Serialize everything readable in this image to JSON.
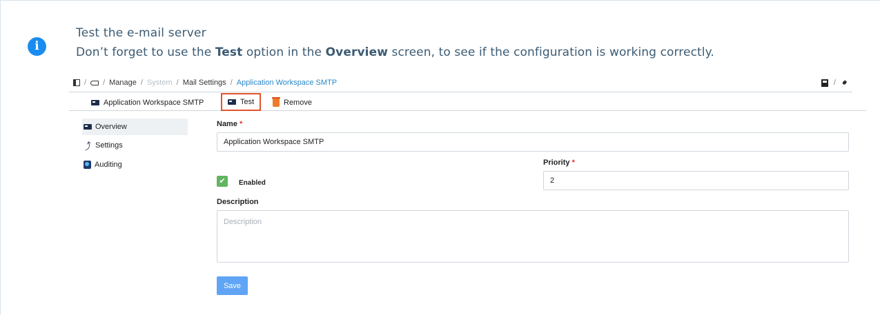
{
  "info": {
    "icon": "info-icon",
    "title": "Test the e-mail server",
    "text_prefix": "Don’t forget to use the ",
    "text_test": "Test",
    "text_middle": " option in the ",
    "text_overview": "Overview",
    "text_suffix": " screen, to see if the configuration is working correctly."
  },
  "breadcrumb": {
    "sep": "/",
    "items": [
      "Manage",
      "System",
      "Mail Settings",
      "Application Workspace SMTP"
    ]
  },
  "toolbar": {
    "title": "Application Workspace SMTP",
    "test_label": "Test",
    "remove_label": "Remove"
  },
  "sidebar": {
    "items": [
      {
        "label": "Overview",
        "icon": "card-icon"
      },
      {
        "label": "Settings",
        "icon": "wrench-icon"
      },
      {
        "label": "Auditing",
        "icon": "audit-icon"
      }
    ]
  },
  "form": {
    "name_label": "Name",
    "required_mark": "*",
    "name_value": "Application Workspace SMTP",
    "priority_label": "Priority",
    "priority_value": "2",
    "enabled_label": "Enabled",
    "enabled_checked": true,
    "description_label": "Description",
    "description_placeholder": "Description",
    "save_label": "Save"
  },
  "colors": {
    "info_accent": "#1a8cf0",
    "highlight_border": "#e4522b",
    "save_button": "#60a4f6",
    "checkbox": "#62b560",
    "required": "#e0312c"
  }
}
